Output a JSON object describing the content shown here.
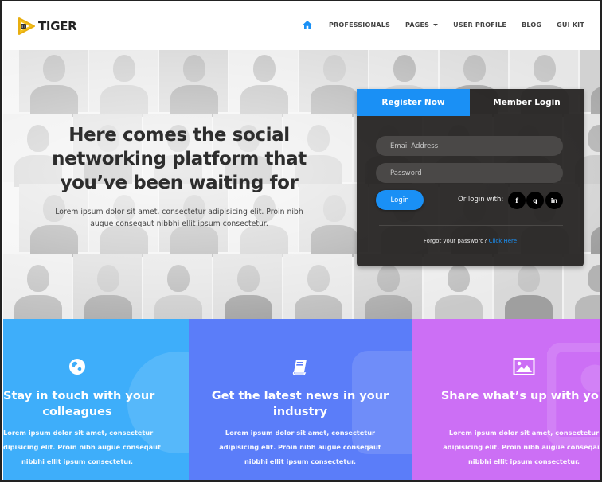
{
  "header": {
    "logo_text": "TIGER",
    "nav": [
      {
        "label": "PROFESSIONALS"
      },
      {
        "label": "PAGES"
      },
      {
        "label": "USER PROFILE"
      },
      {
        "label": "BLOG"
      },
      {
        "label": "GUI KIT"
      }
    ],
    "home_icon": "home-icon",
    "accent_color": "#1a90f5"
  },
  "hero": {
    "title": "Here comes the social networking platform that you’ve been waiting for",
    "subtitle": "Lorem ipsum dolor sit amet, consectetur adipisicing elit. Proin nibh augue conseqaut nibbhi ellit ipsum consectetur."
  },
  "login_panel": {
    "tabs": {
      "register": "Register Now",
      "member_login": "Member Login"
    },
    "email_placeholder": "Email Address",
    "password_placeholder": "Password",
    "login_button": "Login",
    "or_login_with": "Or login with:",
    "social": [
      {
        "icon": "facebook-icon",
        "glyph": "f"
      },
      {
        "icon": "google-plus-icon",
        "glyph": "g"
      },
      {
        "icon": "linkedin-icon",
        "glyph": "in"
      }
    ],
    "forgot_text": "Forgot your password?",
    "forgot_link": "Click Here"
  },
  "features": [
    {
      "icon": "globe-icon",
      "title_line1": "Stay in touch with your",
      "title_line2": "colleagues",
      "text_line1": "Lorem ipsum dolor sit amet, consectetur",
      "text_line2": "dipisicing elit. Proin nibh augue conseqaut",
      "text_line3": "nibbhi ellit ipsum consectetur.",
      "color": "#3eaefa"
    },
    {
      "icon": "book-icon",
      "title_line1": "Get the latest news in your",
      "title_line2": "industry",
      "text_line1": "Lorem ipsum dolor sit amet, consectetur",
      "text_line2": "adipisicing elit. Proin nibh augue conseqaut",
      "text_line3": "nibbhi ellit ipsum consectetur.",
      "color": "#5b7df9"
    },
    {
      "icon": "image-icon",
      "title_line1": "Share what’s up with you",
      "title_line2": "",
      "text_line1": "Lorem ipsum dolor sit amet, consectetur",
      "text_line2": "adipisicing elit. Proin nibh augue conseqaut",
      "text_line3": "nibbhi ellit ipsum consectetur.",
      "color": "#cc6ff5"
    }
  ]
}
